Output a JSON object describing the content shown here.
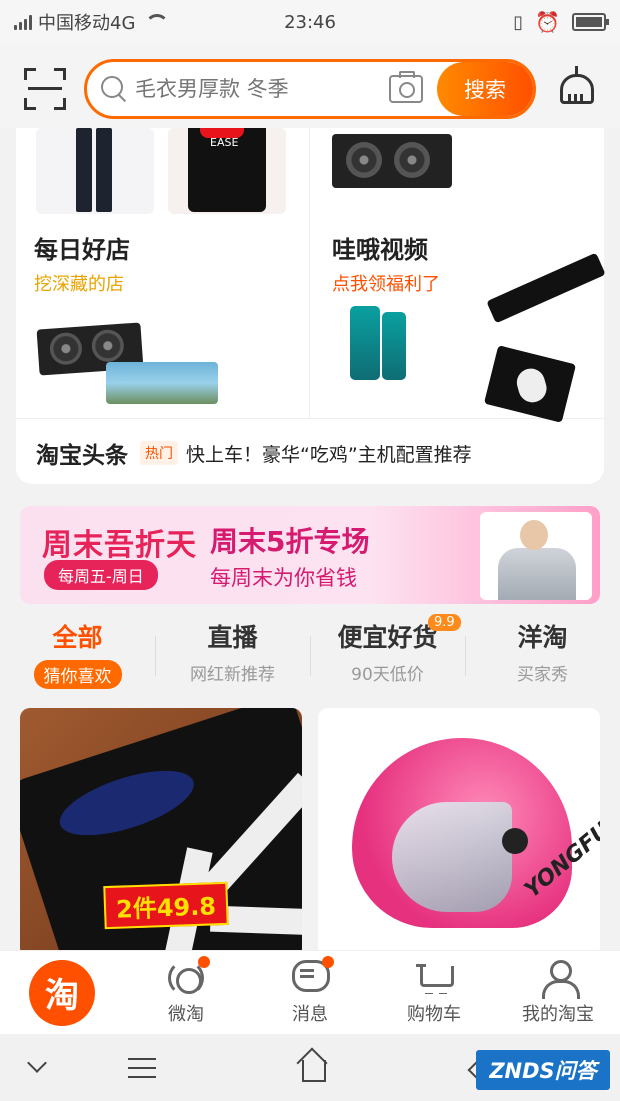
{
  "status_bar": {
    "carrier": "中国移动4G",
    "time": "23:46"
  },
  "search": {
    "placeholder": "毛衣男厚款 冬季",
    "button_label": "搜索"
  },
  "top_card": {
    "daily_shop": {
      "title": "每日好店",
      "subtitle": "挖深藏的店",
      "subtitle_color": "#e8a400"
    },
    "video": {
      "title": "哇哦视频",
      "subtitle": "点我领福利了",
      "subtitle_color": "#ff5000"
    },
    "headline": {
      "label": "淘宝头条",
      "badge": "热门",
      "text": "快上车！豪华“吃鸡”主机配置推荐"
    },
    "product_labels": {
      "sweater_print": "EASE"
    }
  },
  "banner": {
    "logo_text": "周末吾折天",
    "dates": "每周五-周日",
    "title": "周末5折专场",
    "subtitle": "每周末为你省钱"
  },
  "tabs": [
    {
      "title": "全部",
      "sub": "猜你喜欢",
      "active": true
    },
    {
      "title": "直播",
      "sub": "网红新推荐"
    },
    {
      "title": "便宜好货",
      "sub": "90天低价",
      "badge": "9.9"
    },
    {
      "title": "洋淘",
      "sub": "买家秀"
    }
  ],
  "products": {
    "p1_price_tag": "2件49.8",
    "p2_brand": "YONGFU"
  },
  "bottom_nav": [
    {
      "label": "淘",
      "icon": "taobao-logo-icon"
    },
    {
      "label": "微淘",
      "icon": "weitao-icon"
    },
    {
      "label": "消息",
      "icon": "message-icon"
    },
    {
      "label": "购物车",
      "icon": "cart-icon"
    },
    {
      "label": "我的淘宝",
      "icon": "profile-icon"
    }
  ],
  "watermark": "ZNDS问答",
  "colors": {
    "accent": "#ff5000",
    "accent_light": "#ff8a00",
    "banner_pink": "#e6245a"
  }
}
